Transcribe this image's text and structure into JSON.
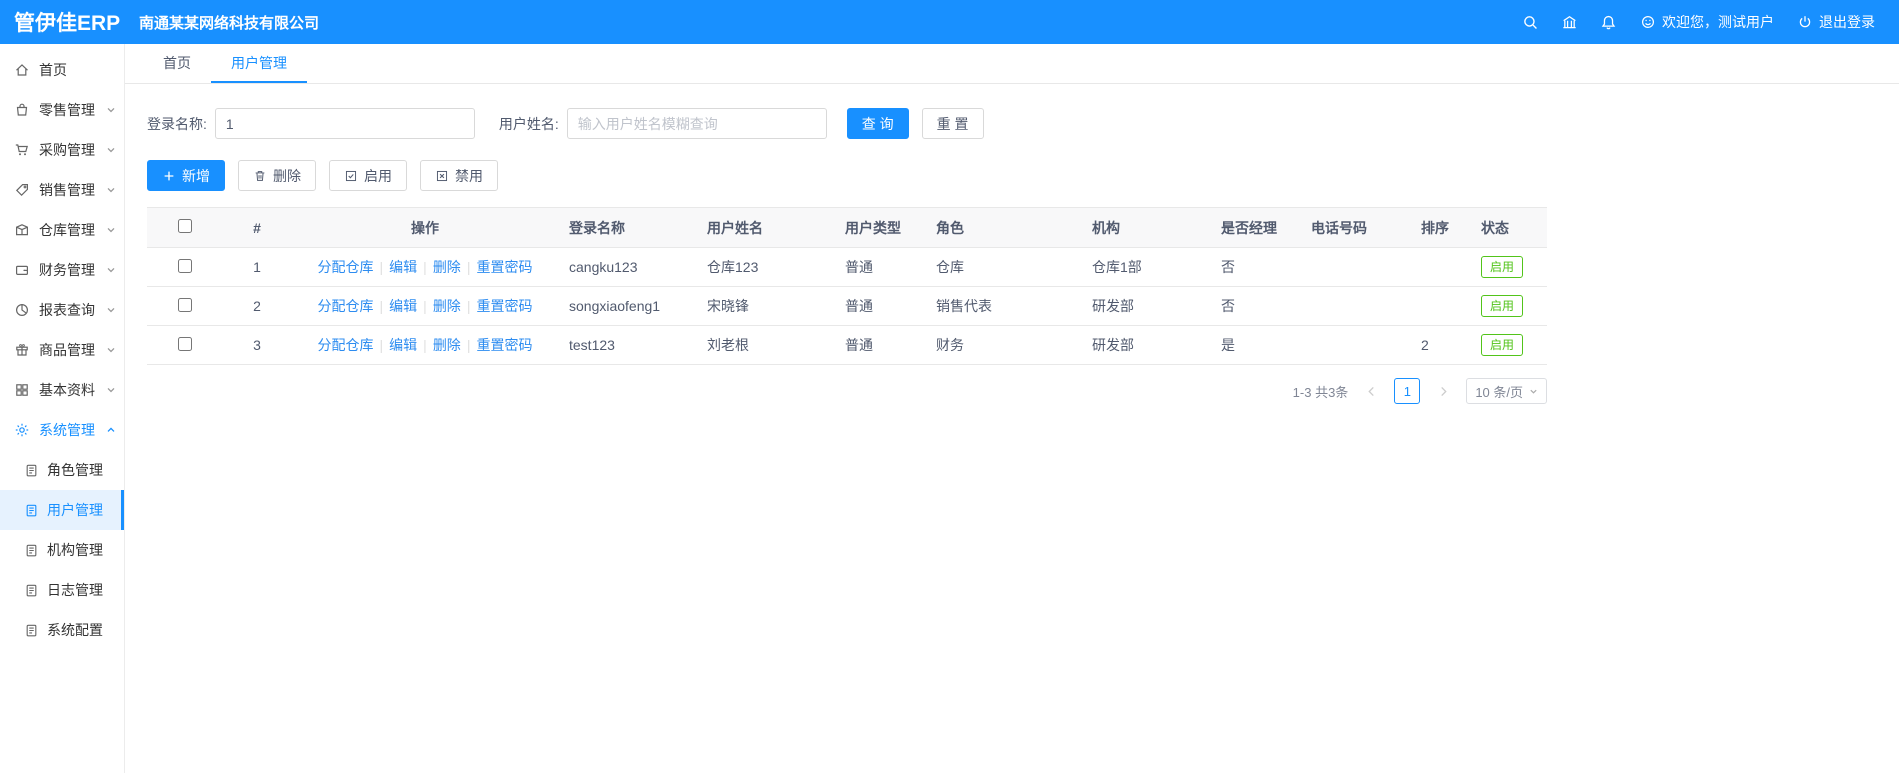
{
  "header": {
    "logo": "管伊佳ERP",
    "company": "南通某某网络科技有限公司",
    "welcome": "欢迎您，测试用户",
    "logout": "退出登录"
  },
  "sidebar": {
    "items": [
      {
        "id": "home",
        "label": "首页",
        "icon": "home-icon",
        "expandable": false,
        "expanded": false,
        "active": false
      },
      {
        "id": "retail",
        "label": "零售管理",
        "icon": "retail-icon",
        "expandable": true,
        "expanded": false,
        "active": false
      },
      {
        "id": "purchase",
        "label": "采购管理",
        "icon": "purchase-icon",
        "expandable": true,
        "expanded": false,
        "active": false
      },
      {
        "id": "sales",
        "label": "销售管理",
        "icon": "sales-icon",
        "expandable": true,
        "expanded": false,
        "active": false
      },
      {
        "id": "warehouse",
        "label": "仓库管理",
        "icon": "warehouse-icon",
        "expandable": true,
        "expanded": false,
        "active": false
      },
      {
        "id": "finance",
        "label": "财务管理",
        "icon": "finance-icon",
        "expandable": true,
        "expanded": false,
        "active": false
      },
      {
        "id": "reports",
        "label": "报表查询",
        "icon": "report-icon",
        "expandable": true,
        "expanded": false,
        "active": false
      },
      {
        "id": "goods",
        "label": "商品管理",
        "icon": "goods-icon",
        "expandable": true,
        "expanded": false,
        "active": false
      },
      {
        "id": "basic-data",
        "label": "基本资料",
        "icon": "basic-data-icon",
        "expandable": true,
        "expanded": false,
        "active": false
      },
      {
        "id": "system",
        "label": "系统管理",
        "icon": "gear-icon",
        "expandable": true,
        "expanded": true,
        "active": true
      }
    ],
    "submenu": [
      {
        "id": "roles",
        "label": "角色管理",
        "active": false
      },
      {
        "id": "users",
        "label": "用户管理",
        "active": true
      },
      {
        "id": "orgs",
        "label": "机构管理",
        "active": false
      },
      {
        "id": "logs",
        "label": "日志管理",
        "active": false
      },
      {
        "id": "config",
        "label": "系统配置",
        "active": false
      }
    ]
  },
  "tabs": [
    {
      "label": "首页",
      "active": false
    },
    {
      "label": "用户管理",
      "active": true
    }
  ],
  "filters": {
    "login_name_label": "登录名称:",
    "login_name_value": "1",
    "user_name_label": "用户姓名:",
    "user_name_placeholder": "输入用户姓名模糊查询",
    "search_button": "查 询",
    "reset_button": "重 置"
  },
  "toolbar": {
    "add": "新增",
    "delete": "删除",
    "enable": "启用",
    "disable": "禁用"
  },
  "table": {
    "headers": [
      "#",
      "操作",
      "登录名称",
      "用户姓名",
      "用户类型",
      "角色",
      "机构",
      "是否经理",
      "电话号码",
      "排序",
      "状态"
    ],
    "operations": [
      "分配仓库",
      "编辑",
      "删除",
      "重置密码"
    ],
    "rows": [
      {
        "index": "1",
        "login": "cangku123",
        "name": "仓库123",
        "type": "普通",
        "role": "仓库",
        "org": "仓库1部",
        "manager": "否",
        "phone": "",
        "sort": "",
        "status": "启用"
      },
      {
        "index": "2",
        "login": "songxiaofeng1",
        "name": "宋晓锋",
        "type": "普通",
        "role": "销售代表",
        "org": "研发部",
        "manager": "否",
        "phone": "",
        "sort": "",
        "status": "启用"
      },
      {
        "index": "3",
        "login": "test123",
        "name": "刘老根",
        "type": "普通",
        "role": "财务",
        "org": "研发部",
        "manager": "是",
        "phone": "",
        "sort": "2",
        "status": "启用"
      }
    ]
  },
  "pagination": {
    "total": "1-3 共3条",
    "current_page": "1",
    "page_size": "10 条/页"
  }
}
